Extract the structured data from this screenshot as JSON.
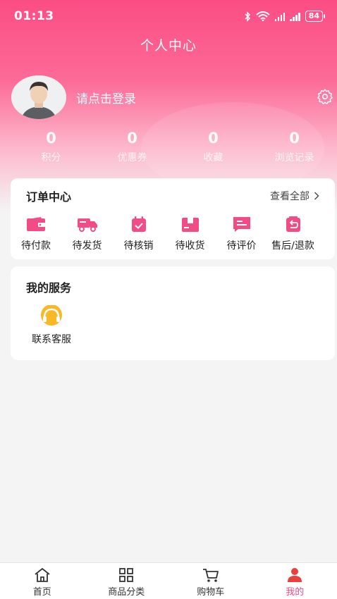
{
  "status_bar": {
    "time": "01:13",
    "battery": "84"
  },
  "header": {
    "title": "个人中心"
  },
  "profile": {
    "login_prompt": "请点击登录"
  },
  "stats": [
    {
      "value": "0",
      "label": "积分"
    },
    {
      "value": "0",
      "label": "优惠券"
    },
    {
      "value": "0",
      "label": "收藏"
    },
    {
      "value": "0",
      "label": "浏览记录"
    }
  ],
  "orders": {
    "title": "订单中心",
    "view_all": "查看全部",
    "items": [
      {
        "label": "待付款",
        "icon": "wallet-icon"
      },
      {
        "label": "待发货",
        "icon": "truck-icon"
      },
      {
        "label": "待核销",
        "icon": "calendar-check-icon"
      },
      {
        "label": "待收货",
        "icon": "package-icon"
      },
      {
        "label": "待评价",
        "icon": "comment-icon"
      },
      {
        "label": "售后/退款",
        "icon": "refund-icon"
      }
    ]
  },
  "services": {
    "title": "我的服务",
    "items": [
      {
        "label": "联系客服",
        "icon": "headset-icon"
      }
    ]
  },
  "tabbar": {
    "items": [
      {
        "label": "首页",
        "icon": "home-icon"
      },
      {
        "label": "商品分类",
        "icon": "grid-icon"
      },
      {
        "label": "购物车",
        "icon": "cart-icon"
      },
      {
        "label": "我的",
        "icon": "user-icon",
        "active": true
      }
    ]
  },
  "colors": {
    "accent": "#f24c86",
    "header_top": "#fb4d85",
    "service_icon": "#f7b928"
  }
}
